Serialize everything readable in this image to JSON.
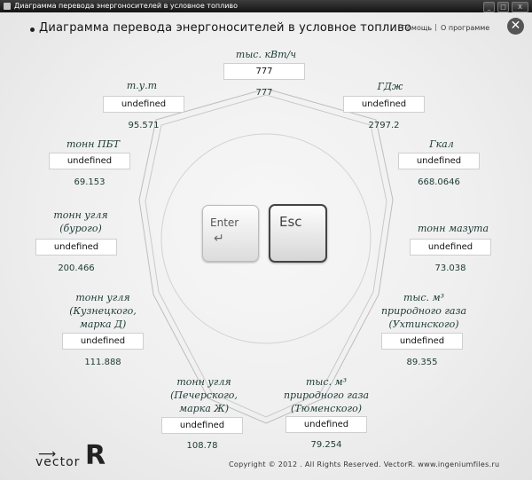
{
  "window": {
    "title": "Диаграмма перевода энергоносителей в условное топливо",
    "min": "_",
    "max": "□",
    "close": "X"
  },
  "header": {
    "title": "Диаграмма перевода энергоносителей в условное топливо",
    "help": "Помощь",
    "separator": "|",
    "about": "О программе",
    "close": "✕"
  },
  "units": [
    {
      "label": "тыс. кВт/ч",
      "input": "777",
      "value": "777"
    },
    {
      "label": "ГДж",
      "input": "undefined",
      "value": "2797.2"
    },
    {
      "label": "Гкал",
      "input": "undefined",
      "value": "668.0646"
    },
    {
      "label": "тонн мазута",
      "input": "undefined",
      "value": "73.038"
    },
    {
      "label_lines": [
        "тыс. м³",
        "природного газа",
        "(Ухтинского)"
      ],
      "input": "undefined",
      "value": "89.355"
    },
    {
      "label_lines": [
        "тыс. м³",
        "природного газа",
        "(Тюменского)"
      ],
      "input": "undefined",
      "value": "79.254"
    },
    {
      "label_lines": [
        "тонн угля",
        "(Печерского,",
        "марка Ж)"
      ],
      "input": "undefined",
      "value": "108.78"
    },
    {
      "label_lines": [
        "тонн угля",
        "(Кузнецкого,",
        "марка Д)"
      ],
      "input": "undefined",
      "value": "111.888"
    },
    {
      "label_lines": [
        "тонн угля",
        "(бурого)"
      ],
      "input": "undefined",
      "value": "200.466"
    },
    {
      "label": "тонн ПБТ",
      "input": "undefined",
      "value": "69.153"
    },
    {
      "label": "т.у.т",
      "input": "undefined",
      "value": "95.571"
    }
  ],
  "keys": {
    "enter": "Enter",
    "enter_arrow": "↵",
    "esc": "Esc"
  },
  "footer": {
    "logo_text": "vector",
    "logo_r": "R",
    "logo_arrow": "⟶",
    "copyright": "Copyright © 2012 . All Rights Reserved. VectorR. www.ingeniumfiles.ru"
  }
}
